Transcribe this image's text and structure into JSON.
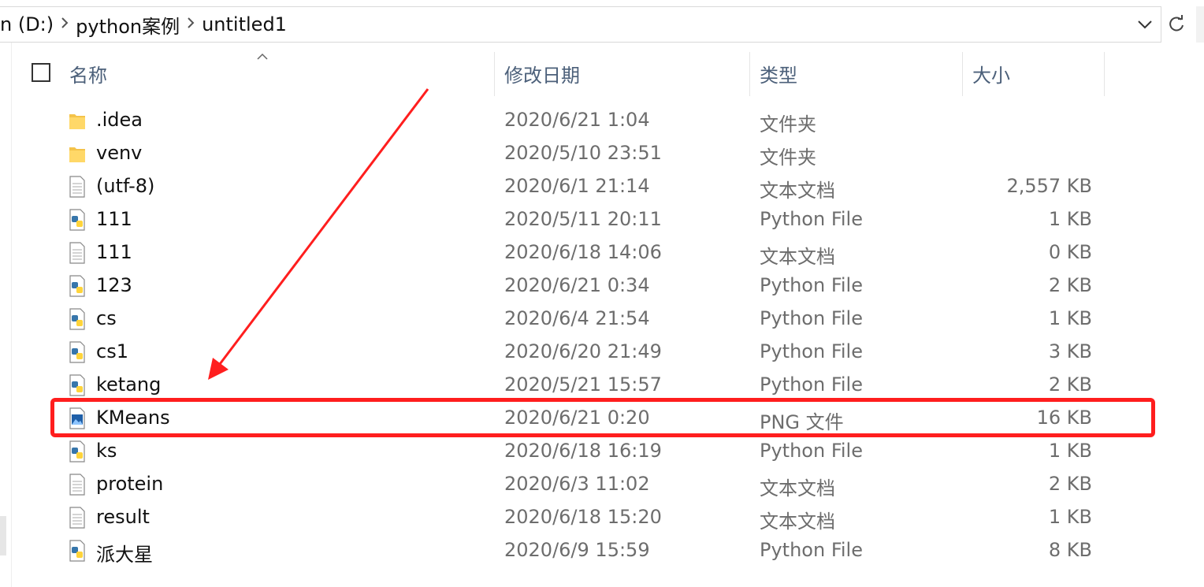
{
  "address": {
    "crumbs": [
      {
        "label": "n (D:)"
      },
      {
        "label": "python案例"
      },
      {
        "label": "untitled1"
      }
    ]
  },
  "columns": {
    "name": "名称",
    "date": "修改日期",
    "type": "类型",
    "size": "大小"
  },
  "files": [
    {
      "name": ".idea",
      "date": "2020/6/21 1:04",
      "type": "文件夹",
      "size": "",
      "icon": "folder-icon"
    },
    {
      "name": "venv",
      "date": "2020/5/10 23:51",
      "type": "文件夹",
      "size": "",
      "icon": "folder-icon"
    },
    {
      "name": "(utf-8)",
      "date": "2020/6/1 21:14",
      "type": "文本文档",
      "size": "2,557 KB",
      "icon": "text-file-icon"
    },
    {
      "name": "111",
      "date": "2020/5/11 20:11",
      "type": "Python File",
      "size": "1 KB",
      "icon": "python-file-icon"
    },
    {
      "name": "111",
      "date": "2020/6/18 14:06",
      "type": "文本文档",
      "size": "0 KB",
      "icon": "text-file-icon"
    },
    {
      "name": "123",
      "date": "2020/6/21 0:34",
      "type": "Python File",
      "size": "2 KB",
      "icon": "python-file-icon"
    },
    {
      "name": "cs",
      "date": "2020/6/4 21:54",
      "type": "Python File",
      "size": "1 KB",
      "icon": "python-file-icon"
    },
    {
      "name": "cs1",
      "date": "2020/6/20 21:49",
      "type": "Python File",
      "size": "3 KB",
      "icon": "python-file-icon"
    },
    {
      "name": "ketang",
      "date": "2020/5/21 15:57",
      "type": "Python File",
      "size": "2 KB",
      "icon": "python-file-icon"
    },
    {
      "name": "KMeans",
      "date": "2020/6/21 0:20",
      "type": "PNG 文件",
      "size": "16 KB",
      "icon": "image-file-icon"
    },
    {
      "name": "ks",
      "date": "2020/6/18 16:19",
      "type": "Python File",
      "size": "1 KB",
      "icon": "python-file-icon"
    },
    {
      "name": "protein",
      "date": "2020/6/3 11:02",
      "type": "文本文档",
      "size": "2 KB",
      "icon": "text-file-icon"
    },
    {
      "name": "result",
      "date": "2020/6/18 15:20",
      "type": "文本文档",
      "size": "1 KB",
      "icon": "text-file-icon"
    },
    {
      "name": "派大星",
      "date": "2020/6/9 15:59",
      "type": "Python File",
      "size": "8 KB",
      "icon": "python-file-icon"
    }
  ],
  "annotation": {
    "highlight_color": "#ff1e1e"
  }
}
